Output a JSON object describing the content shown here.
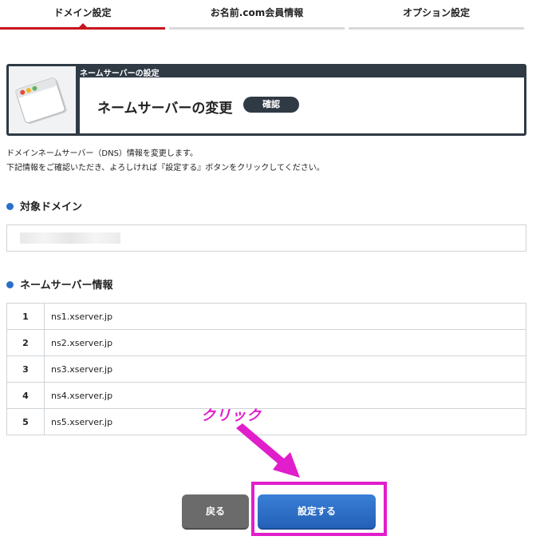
{
  "tabs": [
    {
      "label": "ドメイン設定",
      "active": true
    },
    {
      "label": "お名前.com会員情報",
      "active": false
    },
    {
      "label": "オプション設定",
      "active": false
    }
  ],
  "panel": {
    "subtitle": "ネームサーバーの設定",
    "title": "ネームサーバーの変更",
    "badge": "確認"
  },
  "description": {
    "line1": "ドメインネームサーバー（DNS）情報を変更します。",
    "line2": "下記情報をご確認いただき、よろしければ『設定する』ボタンをクリックしてください。"
  },
  "domain_section": {
    "title": "対象ドメイン"
  },
  "ns_section": {
    "title": "ネームサーバー情報",
    "rows": [
      {
        "num": "1",
        "value": "ns1.xserver.jp"
      },
      {
        "num": "2",
        "value": "ns2.xserver.jp"
      },
      {
        "num": "3",
        "value": "ns3.xserver.jp"
      },
      {
        "num": "4",
        "value": "ns4.xserver.jp"
      },
      {
        "num": "5",
        "value": "ns5.xserver.jp"
      }
    ]
  },
  "annotation": "クリック",
  "buttons": {
    "back": "戻る",
    "submit": "設定する"
  },
  "colors": {
    "accent_red": "#c8141e",
    "panel_dark": "#2f3a44",
    "button_blue": "#2461b8",
    "annotation_magenta": "#e11ecb",
    "dot_blue": "#2a6fc9"
  }
}
